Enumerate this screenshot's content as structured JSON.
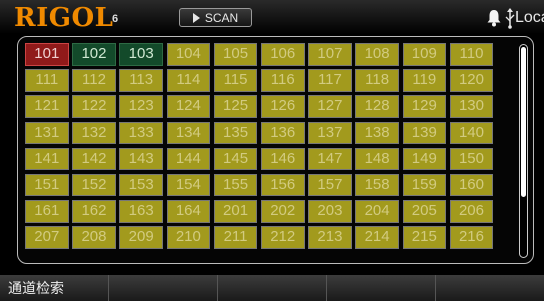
{
  "header": {
    "brand": "RIGOL",
    "brand_sub": "6",
    "scan_label": "SCAN",
    "status": "Local"
  },
  "channels": [
    {
      "label": "101",
      "state": "red"
    },
    {
      "label": "102",
      "state": "green"
    },
    {
      "label": "103",
      "state": "green"
    },
    {
      "label": "104"
    },
    {
      "label": "105"
    },
    {
      "label": "106"
    },
    {
      "label": "107"
    },
    {
      "label": "108"
    },
    {
      "label": "109"
    },
    {
      "label": "110"
    },
    {
      "label": "111"
    },
    {
      "label": "112"
    },
    {
      "label": "113"
    },
    {
      "label": "114"
    },
    {
      "label": "115"
    },
    {
      "label": "116"
    },
    {
      "label": "117"
    },
    {
      "label": "118"
    },
    {
      "label": "119"
    },
    {
      "label": "120"
    },
    {
      "label": "121"
    },
    {
      "label": "122"
    },
    {
      "label": "123"
    },
    {
      "label": "124"
    },
    {
      "label": "125"
    },
    {
      "label": "126"
    },
    {
      "label": "127"
    },
    {
      "label": "128"
    },
    {
      "label": "129"
    },
    {
      "label": "130"
    },
    {
      "label": "131"
    },
    {
      "label": "132"
    },
    {
      "label": "133"
    },
    {
      "label": "134"
    },
    {
      "label": "135"
    },
    {
      "label": "136"
    },
    {
      "label": "137"
    },
    {
      "label": "138"
    },
    {
      "label": "139"
    },
    {
      "label": "140"
    },
    {
      "label": "141"
    },
    {
      "label": "142"
    },
    {
      "label": "143"
    },
    {
      "label": "144"
    },
    {
      "label": "145"
    },
    {
      "label": "146"
    },
    {
      "label": "147"
    },
    {
      "label": "148"
    },
    {
      "label": "149"
    },
    {
      "label": "150"
    },
    {
      "label": "151"
    },
    {
      "label": "152"
    },
    {
      "label": "153"
    },
    {
      "label": "154"
    },
    {
      "label": "155"
    },
    {
      "label": "156"
    },
    {
      "label": "157"
    },
    {
      "label": "158"
    },
    {
      "label": "159"
    },
    {
      "label": "160"
    },
    {
      "label": "161"
    },
    {
      "label": "162"
    },
    {
      "label": "163"
    },
    {
      "label": "164"
    },
    {
      "label": "201"
    },
    {
      "label": "202"
    },
    {
      "label": "203"
    },
    {
      "label": "204"
    },
    {
      "label": "205"
    },
    {
      "label": "206"
    },
    {
      "label": "207"
    },
    {
      "label": "208"
    },
    {
      "label": "209"
    },
    {
      "label": "210"
    },
    {
      "label": "211"
    },
    {
      "label": "212"
    },
    {
      "label": "213"
    },
    {
      "label": "214"
    },
    {
      "label": "215"
    },
    {
      "label": "216"
    }
  ],
  "softkeys": [
    "通道检索",
    "",
    "",
    "",
    ""
  ],
  "colors": {
    "brand": "#f08a00",
    "channel_default": "#a29a1d",
    "channel_red": "#901a1a",
    "channel_green": "#134a2a"
  },
  "icons": [
    "bell-icon",
    "usb-icon",
    "play-icon"
  ]
}
